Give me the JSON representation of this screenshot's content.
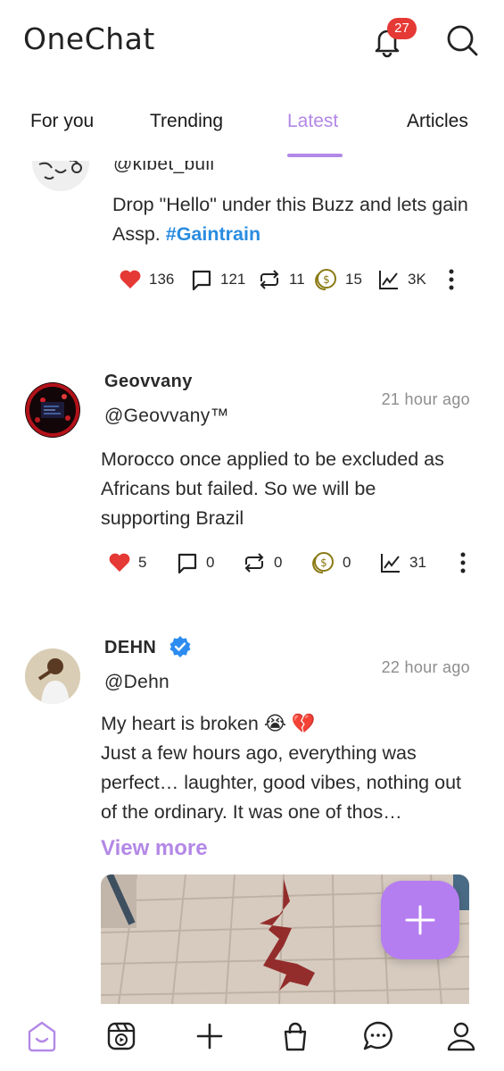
{
  "header": {
    "title": "OneChat",
    "notification_count": "27",
    "icons": [
      "bell-icon",
      "search-icon"
    ]
  },
  "tabs": [
    {
      "label": "For you",
      "active": false
    },
    {
      "label": "Trending",
      "active": false
    },
    {
      "label": "Latest",
      "active": true
    },
    {
      "label": "Articles",
      "active": false
    }
  ],
  "posts": [
    {
      "handle": "@kibet_bull",
      "text": "Drop \"Hello\" under this Buzz and lets gain Assp. ",
      "hashtag": "#Gaintrain",
      "stats": {
        "likes": "136",
        "comments": "121",
        "reposts": "11",
        "tips": "15",
        "views": "3K"
      }
    },
    {
      "author": "Geovvany",
      "handle": "@Geovvany™",
      "time": "21 hour ago",
      "text": "Morocco once applied to be excluded as Africans but failed. So we will be supporting Brazil",
      "stats": {
        "likes": "5",
        "comments": "0",
        "reposts": "0",
        "tips": "0",
        "views": "31"
      }
    },
    {
      "author": "DEHN",
      "verified": true,
      "handle": "@Dehn",
      "time": "22 hour ago",
      "text_line1": "My heart is broken 😭 💔",
      "text_rest": "Just a few hours ago, everything was perfect… laughter, good vibes, nothing out of the ordinary. It was one of thos…",
      "view_more": "View more"
    }
  ],
  "bottom_nav": [
    "home-icon",
    "reels-icon",
    "create-icon",
    "shop-icon",
    "chat-icon",
    "profile-icon"
  ],
  "colors": {
    "accent": "#b388e6",
    "fab": "#b57ef0",
    "like": "#e53935",
    "hashtag": "#2a8ce0",
    "badge": "#e53935",
    "verified": "#2d8cf0",
    "tip": "#8a7a14"
  }
}
